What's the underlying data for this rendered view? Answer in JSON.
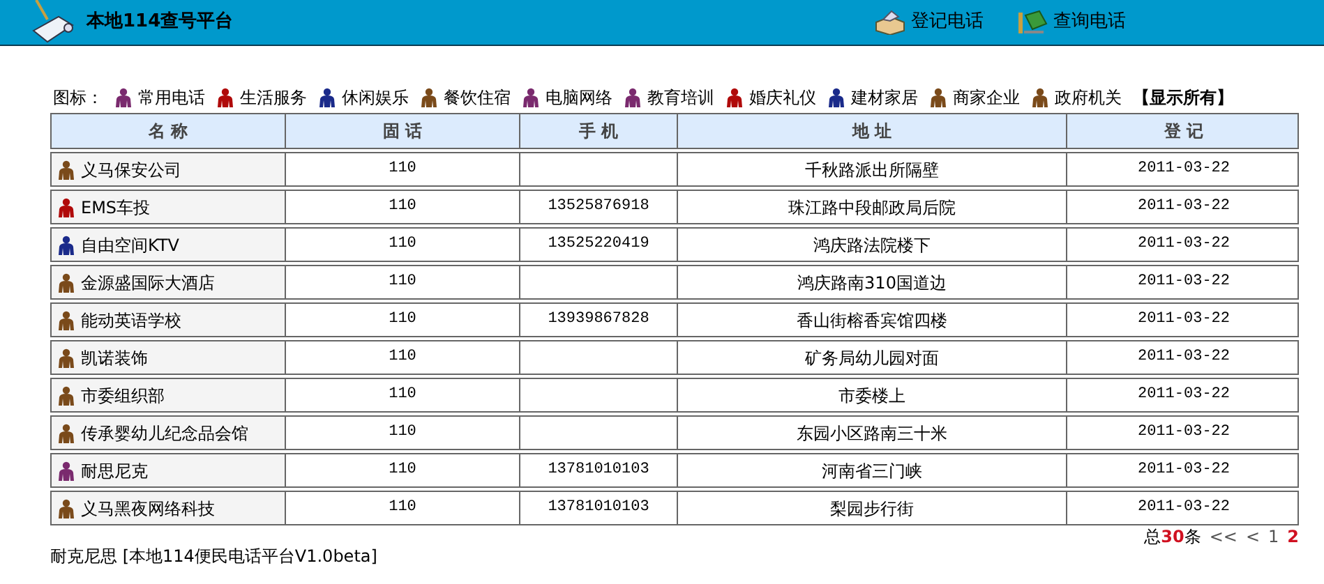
{
  "header": {
    "title": "本地114查号平台",
    "nav": [
      "登记电话",
      "查询电话"
    ]
  },
  "legend": {
    "label": "图标：",
    "show_all": "【显示所有】",
    "categories": [
      {
        "name": "常用电话",
        "color": "#7a2a6e"
      },
      {
        "name": "生活服务",
        "color": "#b00a0a"
      },
      {
        "name": "休闲娱乐",
        "color": "#1a2a8a"
      },
      {
        "name": "餐饮住宿",
        "color": "#7a4a1a"
      },
      {
        "name": "电脑网络",
        "color": "#7a2a6e"
      },
      {
        "name": "教育培训",
        "color": "#7a2a6e"
      },
      {
        "name": "婚庆礼仪",
        "color": "#b00a0a"
      },
      {
        "name": "建材家居",
        "color": "#1a2a8a"
      },
      {
        "name": "商家企业",
        "color": "#7a4a1a"
      },
      {
        "name": "政府机关",
        "color": "#7a4a1a"
      }
    ]
  },
  "table": {
    "columns": [
      "名 称",
      "固 话",
      "手 机",
      "地 址",
      "登 记"
    ],
    "rows": [
      {
        "color": "#7a4a1a",
        "name": "义马保安公司",
        "landline": "110",
        "mobile": "",
        "address": "千秋路派出所隔壁",
        "date": "2011-03-22"
      },
      {
        "color": "#b00a0a",
        "name": "EMS车投",
        "landline": "110",
        "mobile": "13525876918",
        "address": "珠江路中段邮政局后院",
        "date": "2011-03-22"
      },
      {
        "color": "#1a2a8a",
        "name": "自由空间KTV",
        "landline": "110",
        "mobile": "13525220419",
        "address": "鸿庆路法院楼下",
        "date": "2011-03-22"
      },
      {
        "color": "#7a4a1a",
        "name": "金源盛国际大酒店",
        "landline": "110",
        "mobile": "",
        "address": "鸿庆路南310国道边",
        "date": "2011-03-22"
      },
      {
        "color": "#7a4a1a",
        "name": "能动英语学校",
        "landline": "110",
        "mobile": "13939867828",
        "address": "香山街榕香宾馆四楼",
        "date": "2011-03-22"
      },
      {
        "color": "#7a4a1a",
        "name": "凯诺装饰",
        "landline": "110",
        "mobile": "",
        "address": "矿务局幼儿园对面",
        "date": "2011-03-22"
      },
      {
        "color": "#7a4a1a",
        "name": "市委组织部",
        "landline": "110",
        "mobile": "",
        "address": "市委楼上",
        "date": "2011-03-22"
      },
      {
        "color": "#7a4a1a",
        "name": "传承婴幼儿纪念品会馆",
        "landline": "110",
        "mobile": "",
        "address": "东园小区路南三十米",
        "date": "2011-03-22"
      },
      {
        "color": "#7a2a6e",
        "name": "耐思尼克",
        "landline": "110",
        "mobile": "13781010103",
        "address": "河南省三门峡",
        "date": "2011-03-22"
      },
      {
        "color": "#7a4a1a",
        "name": "义马黑夜网络科技",
        "landline": "110",
        "mobile": "13781010103",
        "address": "梨园步行街",
        "date": "2011-03-22"
      }
    ]
  },
  "pagination": {
    "total": "总**30**条",
    "first": "<<",
    "prev": "<",
    "pages": [
      {
        "label": "1",
        "selected": false
      },
      {
        "label": "2",
        "selected": true
      }
    ]
  },
  "footer": "耐克尼思 [本地114便民电话平台V1.0beta]"
}
